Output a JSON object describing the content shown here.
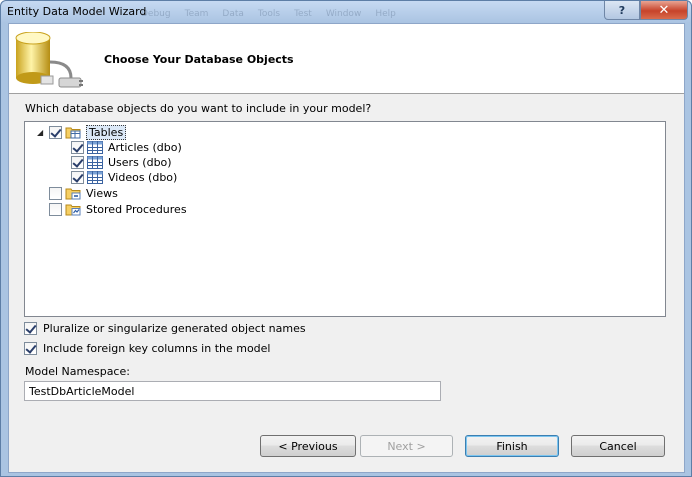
{
  "window": {
    "title": "Entity Data Model Wizard",
    "help_label": "?",
    "close_label": "✕",
    "background_menu": [
      "Debug",
      "Team",
      "Data",
      "Tools",
      "Test",
      "Window",
      "Help"
    ]
  },
  "header": {
    "title": "Choose Your Database Objects",
    "icon": "database-plug-icon"
  },
  "question": "Which database objects do you want to include in your model?",
  "tree": {
    "tables": {
      "label": "Tables",
      "checked": true,
      "expanded": true,
      "icon": "tables-folder-icon"
    },
    "tables_children": [
      {
        "label": "Articles (dbo)",
        "checked": true,
        "icon": "table-grid-icon"
      },
      {
        "label": "Users (dbo)",
        "checked": true,
        "icon": "table-grid-icon"
      },
      {
        "label": "Videos (dbo)",
        "checked": true,
        "icon": "table-grid-icon"
      }
    ],
    "views": {
      "label": "Views",
      "checked": false,
      "icon": "views-folder-icon"
    },
    "procedures": {
      "label": "Stored Procedures",
      "checked": false,
      "icon": "procedures-folder-icon"
    }
  },
  "options": {
    "pluralize": {
      "label": "Pluralize or singularize generated object names",
      "checked": true
    },
    "foreign_keys": {
      "label": "Include foreign key columns in the model",
      "checked": true
    }
  },
  "namespace": {
    "label": "Model Namespace:",
    "value": "TestDbArticleModel"
  },
  "buttons": {
    "previous": "< Previous",
    "next": "Next >",
    "finish": "Finish",
    "cancel": "Cancel"
  },
  "colors": {
    "frame": "#aac4e2",
    "client": "#f0f0f0",
    "close": "#c7432a"
  }
}
